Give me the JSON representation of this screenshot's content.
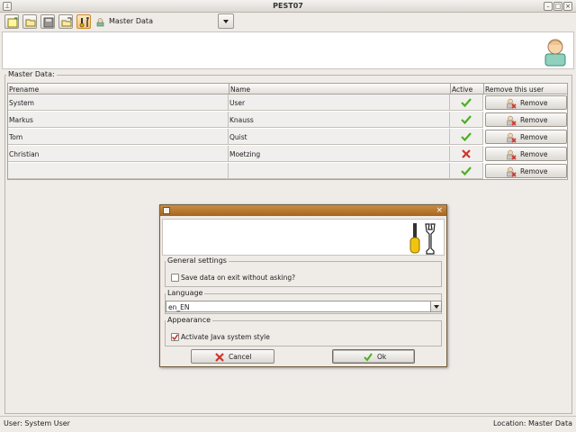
{
  "window": {
    "title": "PEST07"
  },
  "toolbar": {
    "module_label": "Master Data",
    "buttons": [
      "new-icon",
      "open-icon",
      "save-icon",
      "export-icon",
      "settings-icon"
    ]
  },
  "master_data": {
    "group_title": "Master Data:",
    "columns": [
      "Prename",
      "Name",
      "Active",
      "Remove this user"
    ],
    "rows": [
      {
        "prename": "System",
        "name": "User",
        "active": true,
        "action": "Remove"
      },
      {
        "prename": "Markus",
        "name": "Knauss",
        "active": true,
        "action": "Remove"
      },
      {
        "prename": "Tom",
        "name": "Quist",
        "active": true,
        "action": "Remove"
      },
      {
        "prename": "Christian",
        "name": "Moetzing",
        "active": false,
        "action": "Remove"
      },
      {
        "prename": "",
        "name": "",
        "active": true,
        "action": "Remove"
      }
    ]
  },
  "dialog": {
    "close_glyph": "×",
    "general": {
      "title": "General settings",
      "save_on_exit_label": "Save data on exit without asking?",
      "save_on_exit_checked": false
    },
    "language": {
      "title": "Language",
      "value": "en_EN"
    },
    "appearance": {
      "title": "Appearance",
      "java_style_label": "Activate Java system style",
      "java_style_checked": true
    },
    "cancel_label": "Cancel",
    "ok_label": "Ok"
  },
  "status": {
    "left": "User: System User",
    "right": "Location: Master Data"
  },
  "colors": {
    "accent": "#c98d45",
    "check_green": "#4caf26",
    "cross_red": "#d0342c"
  }
}
